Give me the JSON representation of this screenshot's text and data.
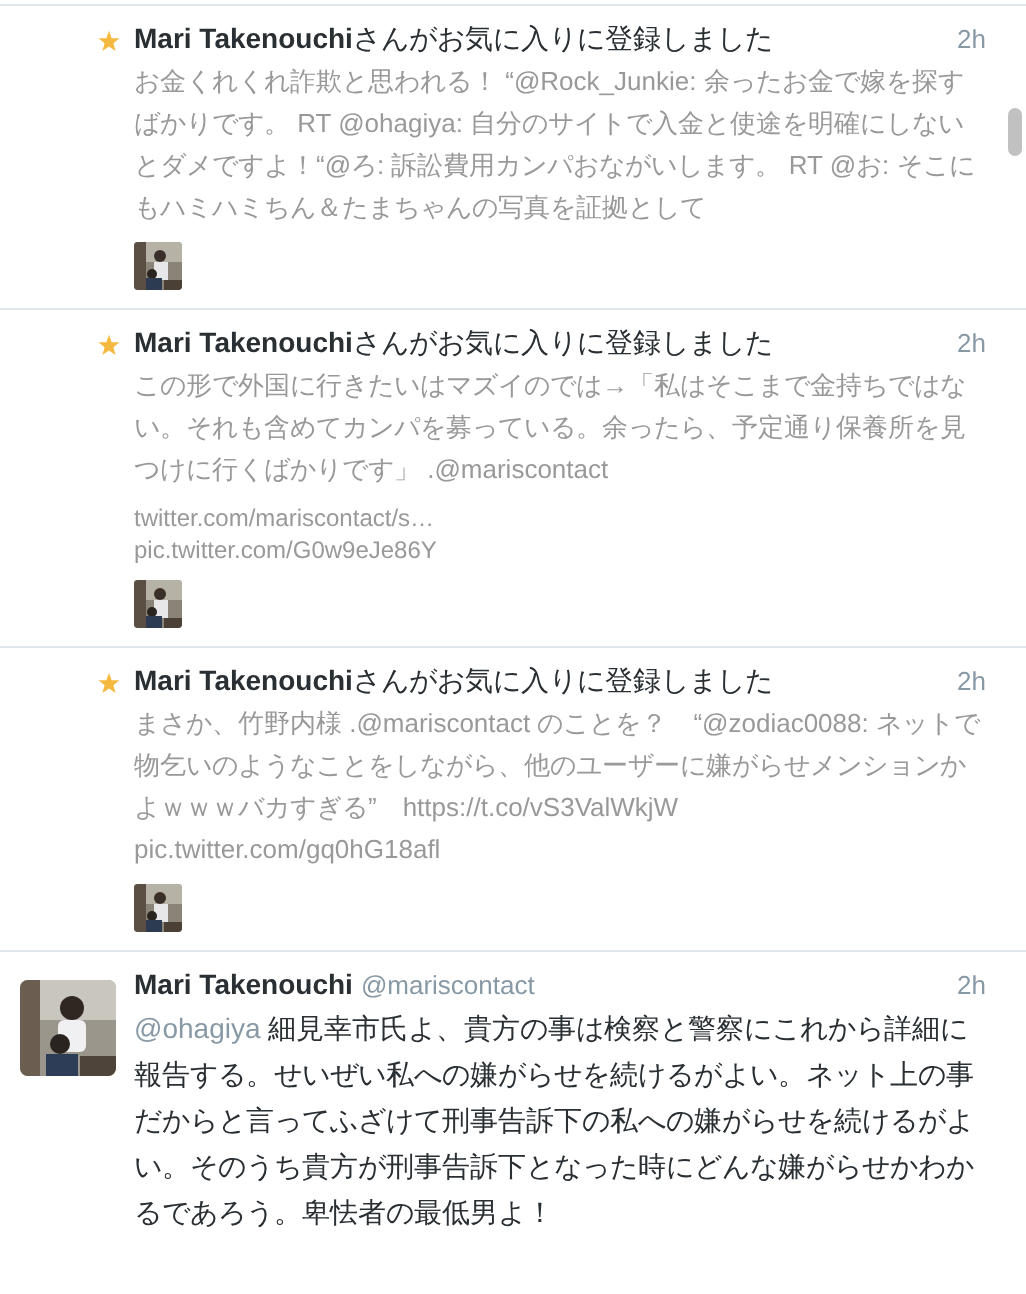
{
  "items": [
    {
      "kind": "favorite",
      "user": "Mari Takenouchi",
      "action": "さんがお気に入りに登録しました",
      "time": "2h",
      "text": "お金くれくれ詐欺と思われる！ “@Rock_Junkie: 余ったお金で嫁を探すばかりです。 RT @ohagiya: 自分のサイトで入金と使途を明確にしないとダメですよ！“@ろ: 訴訟費用カンパおながいします。 RT @お: そこにもハミハミちん＆たまちゃんの写真を証拠として"
    },
    {
      "kind": "favorite",
      "user": "Mari Takenouchi",
      "action": "さんがお気に入りに登録しました",
      "time": "2h",
      "text": "この形で外国に行きたいはマズイのでは→「私はそこまで金持ちではない。それも含めてカンパを募っている。余ったら、予定通り保養所を見つけに行くばかりです」 .@mariscontact",
      "links": [
        "twitter.com/mariscontact/s…",
        "pic.twitter.com/G0w9eJe86Y"
      ]
    },
    {
      "kind": "favorite",
      "user": "Mari Takenouchi",
      "action": "さんがお気に入りに登録しました",
      "time": "2h",
      "text": "まさか、竹野内様 .@mariscontact のことを？　“@zodiac0088: ネットで物乞いのようなことをしながら、他のユーザーに嫌がらせメンションかよｗｗｗバカすぎる”　https://t.co/vS3ValWkjW　 pic.twitter.com/gq0hG18afl"
    },
    {
      "kind": "tweet",
      "user": "Mari Takenouchi",
      "handle": "@mariscontact",
      "time": "2h",
      "mention": "@ohagiya",
      "text": "細見幸市氏よ、貴方の事は検察と警察にこれから詳細に報告する。せいぜい私への嫌がらせを続けるがよい。ネット上の事だからと言ってふざけて刑事告訴下の私への嫌がらせを続けるがよい。そのうち貴方が刑事告訴下となった時にどんな嫌がらせかわかるであろう。卑怯者の最低男よ！"
    }
  ]
}
